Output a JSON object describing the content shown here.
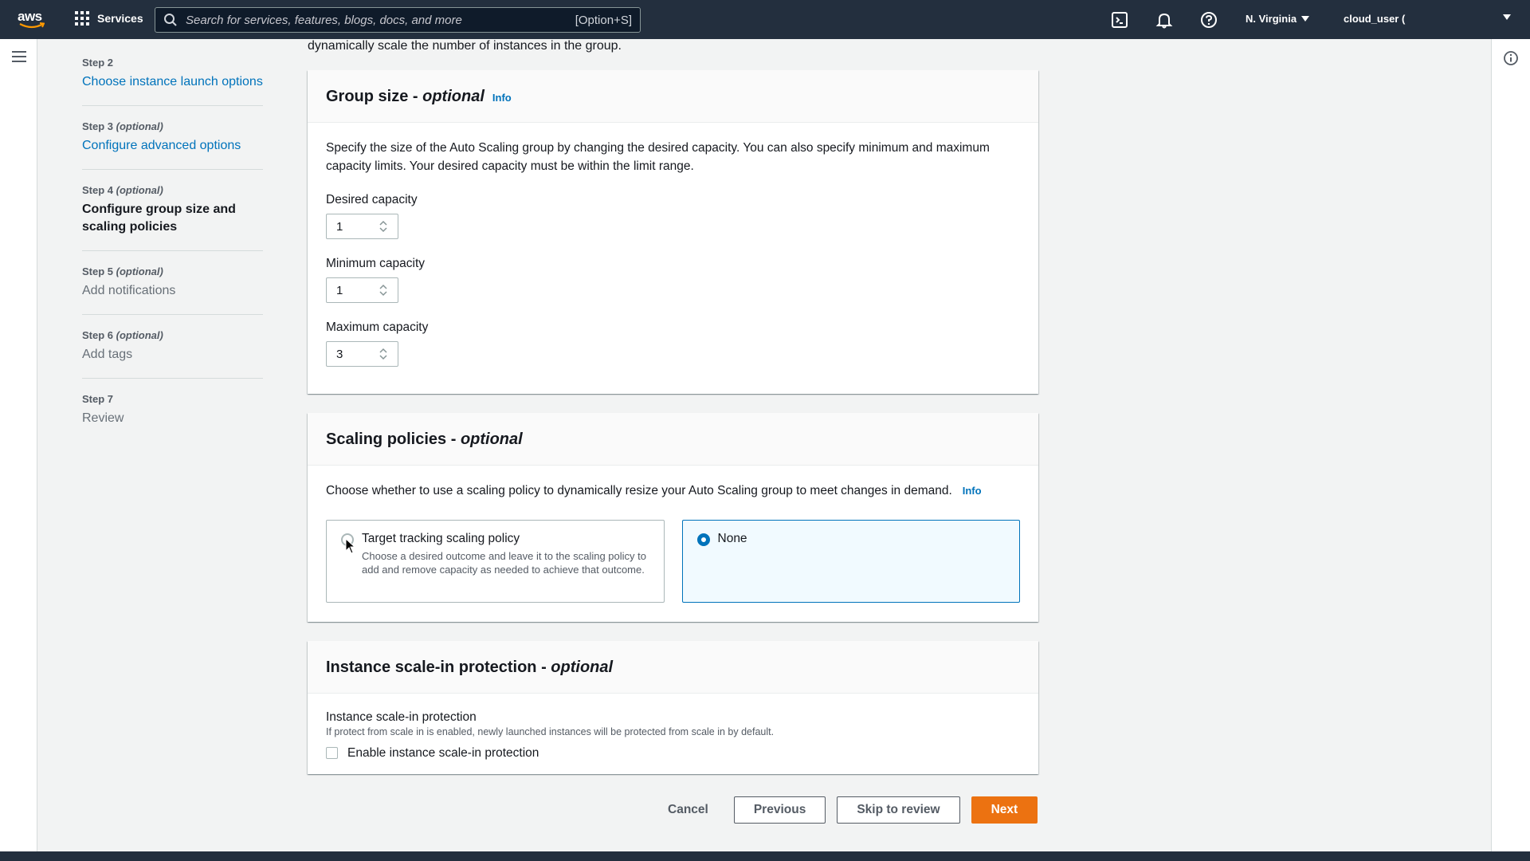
{
  "topnav": {
    "logo_text": "aws",
    "services_label": "Services",
    "search_placeholder": "Search for services, features, blogs, docs, and more",
    "search_shortcut": "[Option+S]",
    "region": "N. Virginia",
    "user": "cloud_user ("
  },
  "steps": [
    {
      "num": "Step 2",
      "optional": "",
      "title": "Choose instance launch options",
      "state": "link"
    },
    {
      "num": "Step 3",
      "optional": "(optional)",
      "title": "Configure advanced options",
      "state": "link"
    },
    {
      "num": "Step 4",
      "optional": "(optional)",
      "title": "Configure group size and scaling policies",
      "state": "active"
    },
    {
      "num": "Step 5",
      "optional": "(optional)",
      "title": "Add notifications",
      "state": "disabled"
    },
    {
      "num": "Step 6",
      "optional": "(optional)",
      "title": "Add tags",
      "state": "disabled"
    },
    {
      "num": "Step 7",
      "optional": "",
      "title": "Review",
      "state": "disabled"
    }
  ],
  "intro_text": "dynamically scale the number of instances in the group.",
  "group_size": {
    "title": "Group size - ",
    "title_optional": "optional",
    "info": "Info",
    "description": "Specify the size of the Auto Scaling group by changing the desired capacity. You can also specify minimum and maximum capacity limits. Your desired capacity must be within the limit range.",
    "desired_label": "Desired capacity",
    "desired_value": "1",
    "min_label": "Minimum capacity",
    "min_value": "1",
    "max_label": "Maximum capacity",
    "max_value": "3"
  },
  "scaling": {
    "title": "Scaling policies - ",
    "title_optional": "optional",
    "description": "Choose whether to use a scaling policy to dynamically resize your Auto Scaling group to meet changes in demand.",
    "info": "Info",
    "option1_title": "Target tracking scaling policy",
    "option1_desc": "Choose a desired outcome and leave it to the scaling policy to add and remove capacity as needed to achieve that outcome.",
    "option2_title": "None",
    "selected": "None"
  },
  "protection": {
    "title": "Instance scale-in protection - ",
    "title_optional": "optional",
    "label": "Instance scale-in protection",
    "sublabel": "If protect from scale in is enabled, newly launched instances will be protected from scale in by default.",
    "checkbox_label": "Enable instance scale-in protection"
  },
  "footer": {
    "cancel": "Cancel",
    "previous": "Previous",
    "skip": "Skip to review",
    "next": "Next"
  },
  "colors": {
    "nav_bg": "#232f3e",
    "link": "#0073bb",
    "primary": "#ec7211",
    "page_bg": "#f2f3f3"
  }
}
